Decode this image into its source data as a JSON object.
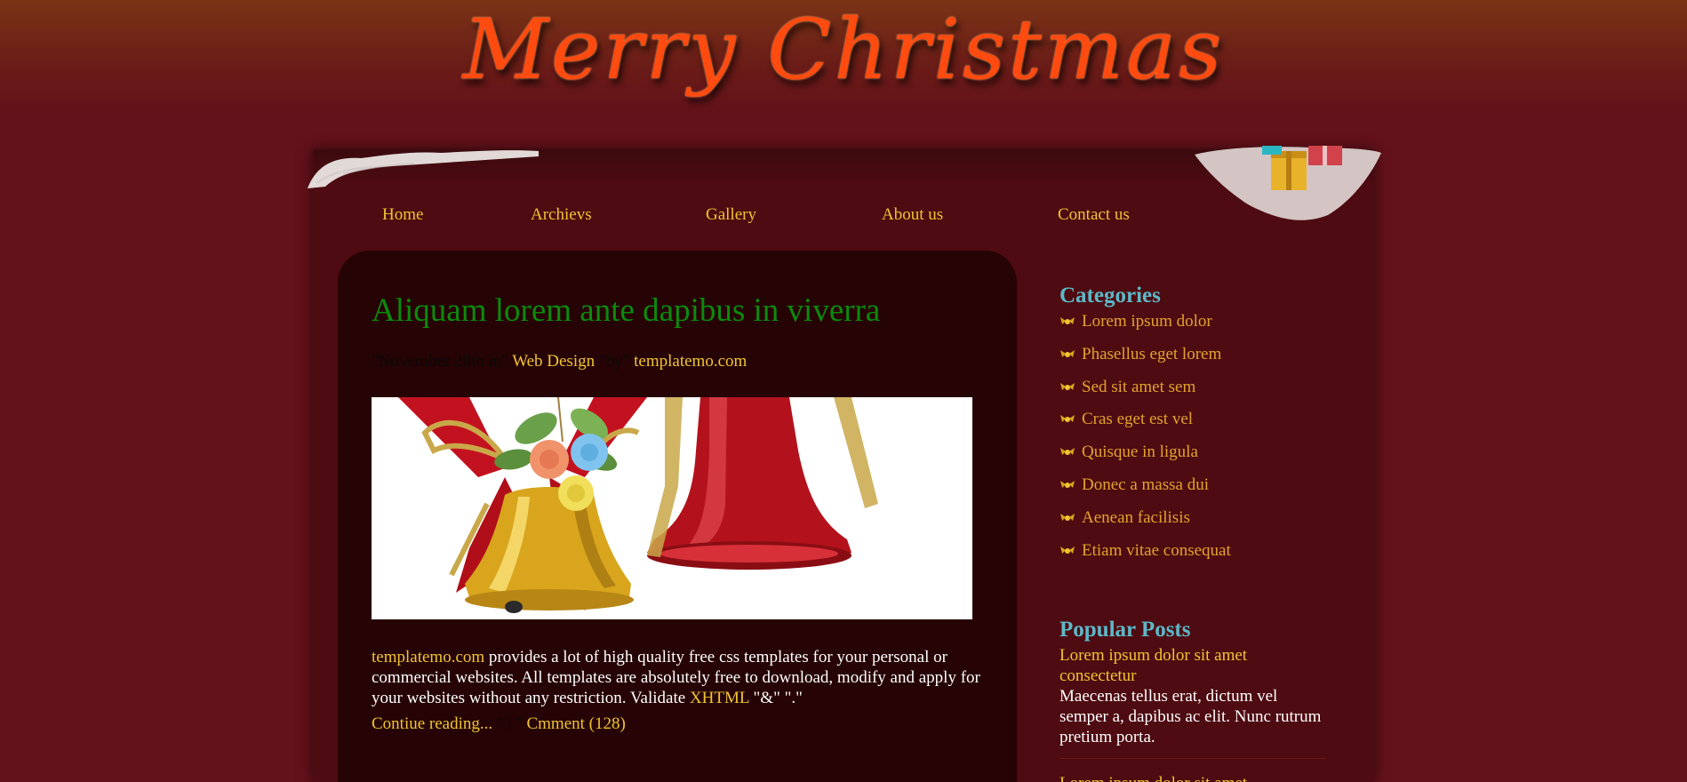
{
  "header": {
    "title": "Merry Christmas"
  },
  "nav": {
    "items": [
      "Home",
      "Archievs",
      "Gallery",
      "About us",
      "Contact us"
    ]
  },
  "post": {
    "title": "Aliquam lorem ante dapibus in viverra",
    "meta_prefix": "\"November 28th in\"",
    "meta_category": "Web Design",
    "meta_by": "\"by\"",
    "meta_author": "templatemo.com",
    "body_link": "templatemo.com",
    "body_text": " provides a lot of high quality free css templates for your personal or commercial websites. All templates are absolutely free to download, modify and apply for your websites without any restriction. Validate ",
    "body_xhtml": "XHTML",
    "body_tail": " \"&\" \".\"",
    "read_more": "Contiue reading...",
    "separator": "\" | \"",
    "comments": "Cmment (128)"
  },
  "sidebar": {
    "categories_heading": "Categories",
    "categories": [
      "Lorem ipsum dolor",
      "Phasellus eget lorem",
      "Sed sit amet sem",
      "Cras eget est vel",
      "Quisque in ligula",
      "Donec a massa dui",
      "Aenean facilisis",
      "Etiam vitae consequat"
    ],
    "popular_heading": "Popular Posts",
    "popular": [
      {
        "title": "Lorem ipsum dolor sit amet consectetur",
        "text": "Maecenas tellus erat, dictum vel semper a, dapibus ac elit. Nunc rutrum pretium porta."
      },
      {
        "title": "Lorem ipsum dolor sit amet",
        "text": ""
      }
    ]
  },
  "colors": {
    "title": "#ff4a10",
    "nav_link": "#f0c531",
    "post_title": "#0c8a0c",
    "sidebar_heading": "#5cb8c8",
    "category_link": "#e3a32d",
    "background": "#63111a"
  },
  "icons": {
    "category_bullet": "holly-icon"
  }
}
